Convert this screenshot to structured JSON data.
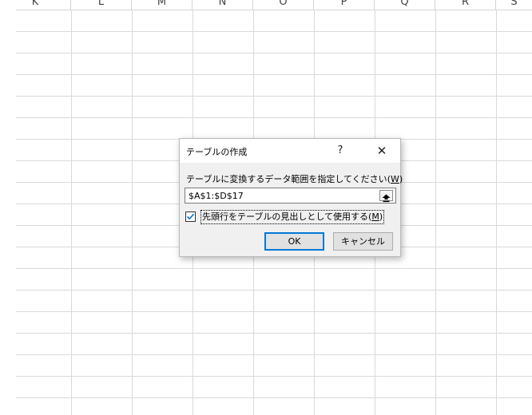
{
  "spreadsheet": {
    "columns": [
      "K",
      "L",
      "M",
      "N",
      "O",
      "P",
      "Q",
      "R",
      "S"
    ]
  },
  "dialog": {
    "title": "テーブルの作成",
    "help_label": "?",
    "close_label": "✕",
    "prompt_label": "テーブルに変換するデータ範囲を指定してください",
    "prompt_accel": "W",
    "range_value": "$A$1:$D$17",
    "collapse_icon": "upload-arrow-icon",
    "header_checkbox": {
      "label": "先頭行をテーブルの見出しとして使用する",
      "accel": "M",
      "checked": true
    },
    "ok_label": "OK",
    "cancel_label": "キャンセル",
    "accent_color": "#0078d7"
  }
}
